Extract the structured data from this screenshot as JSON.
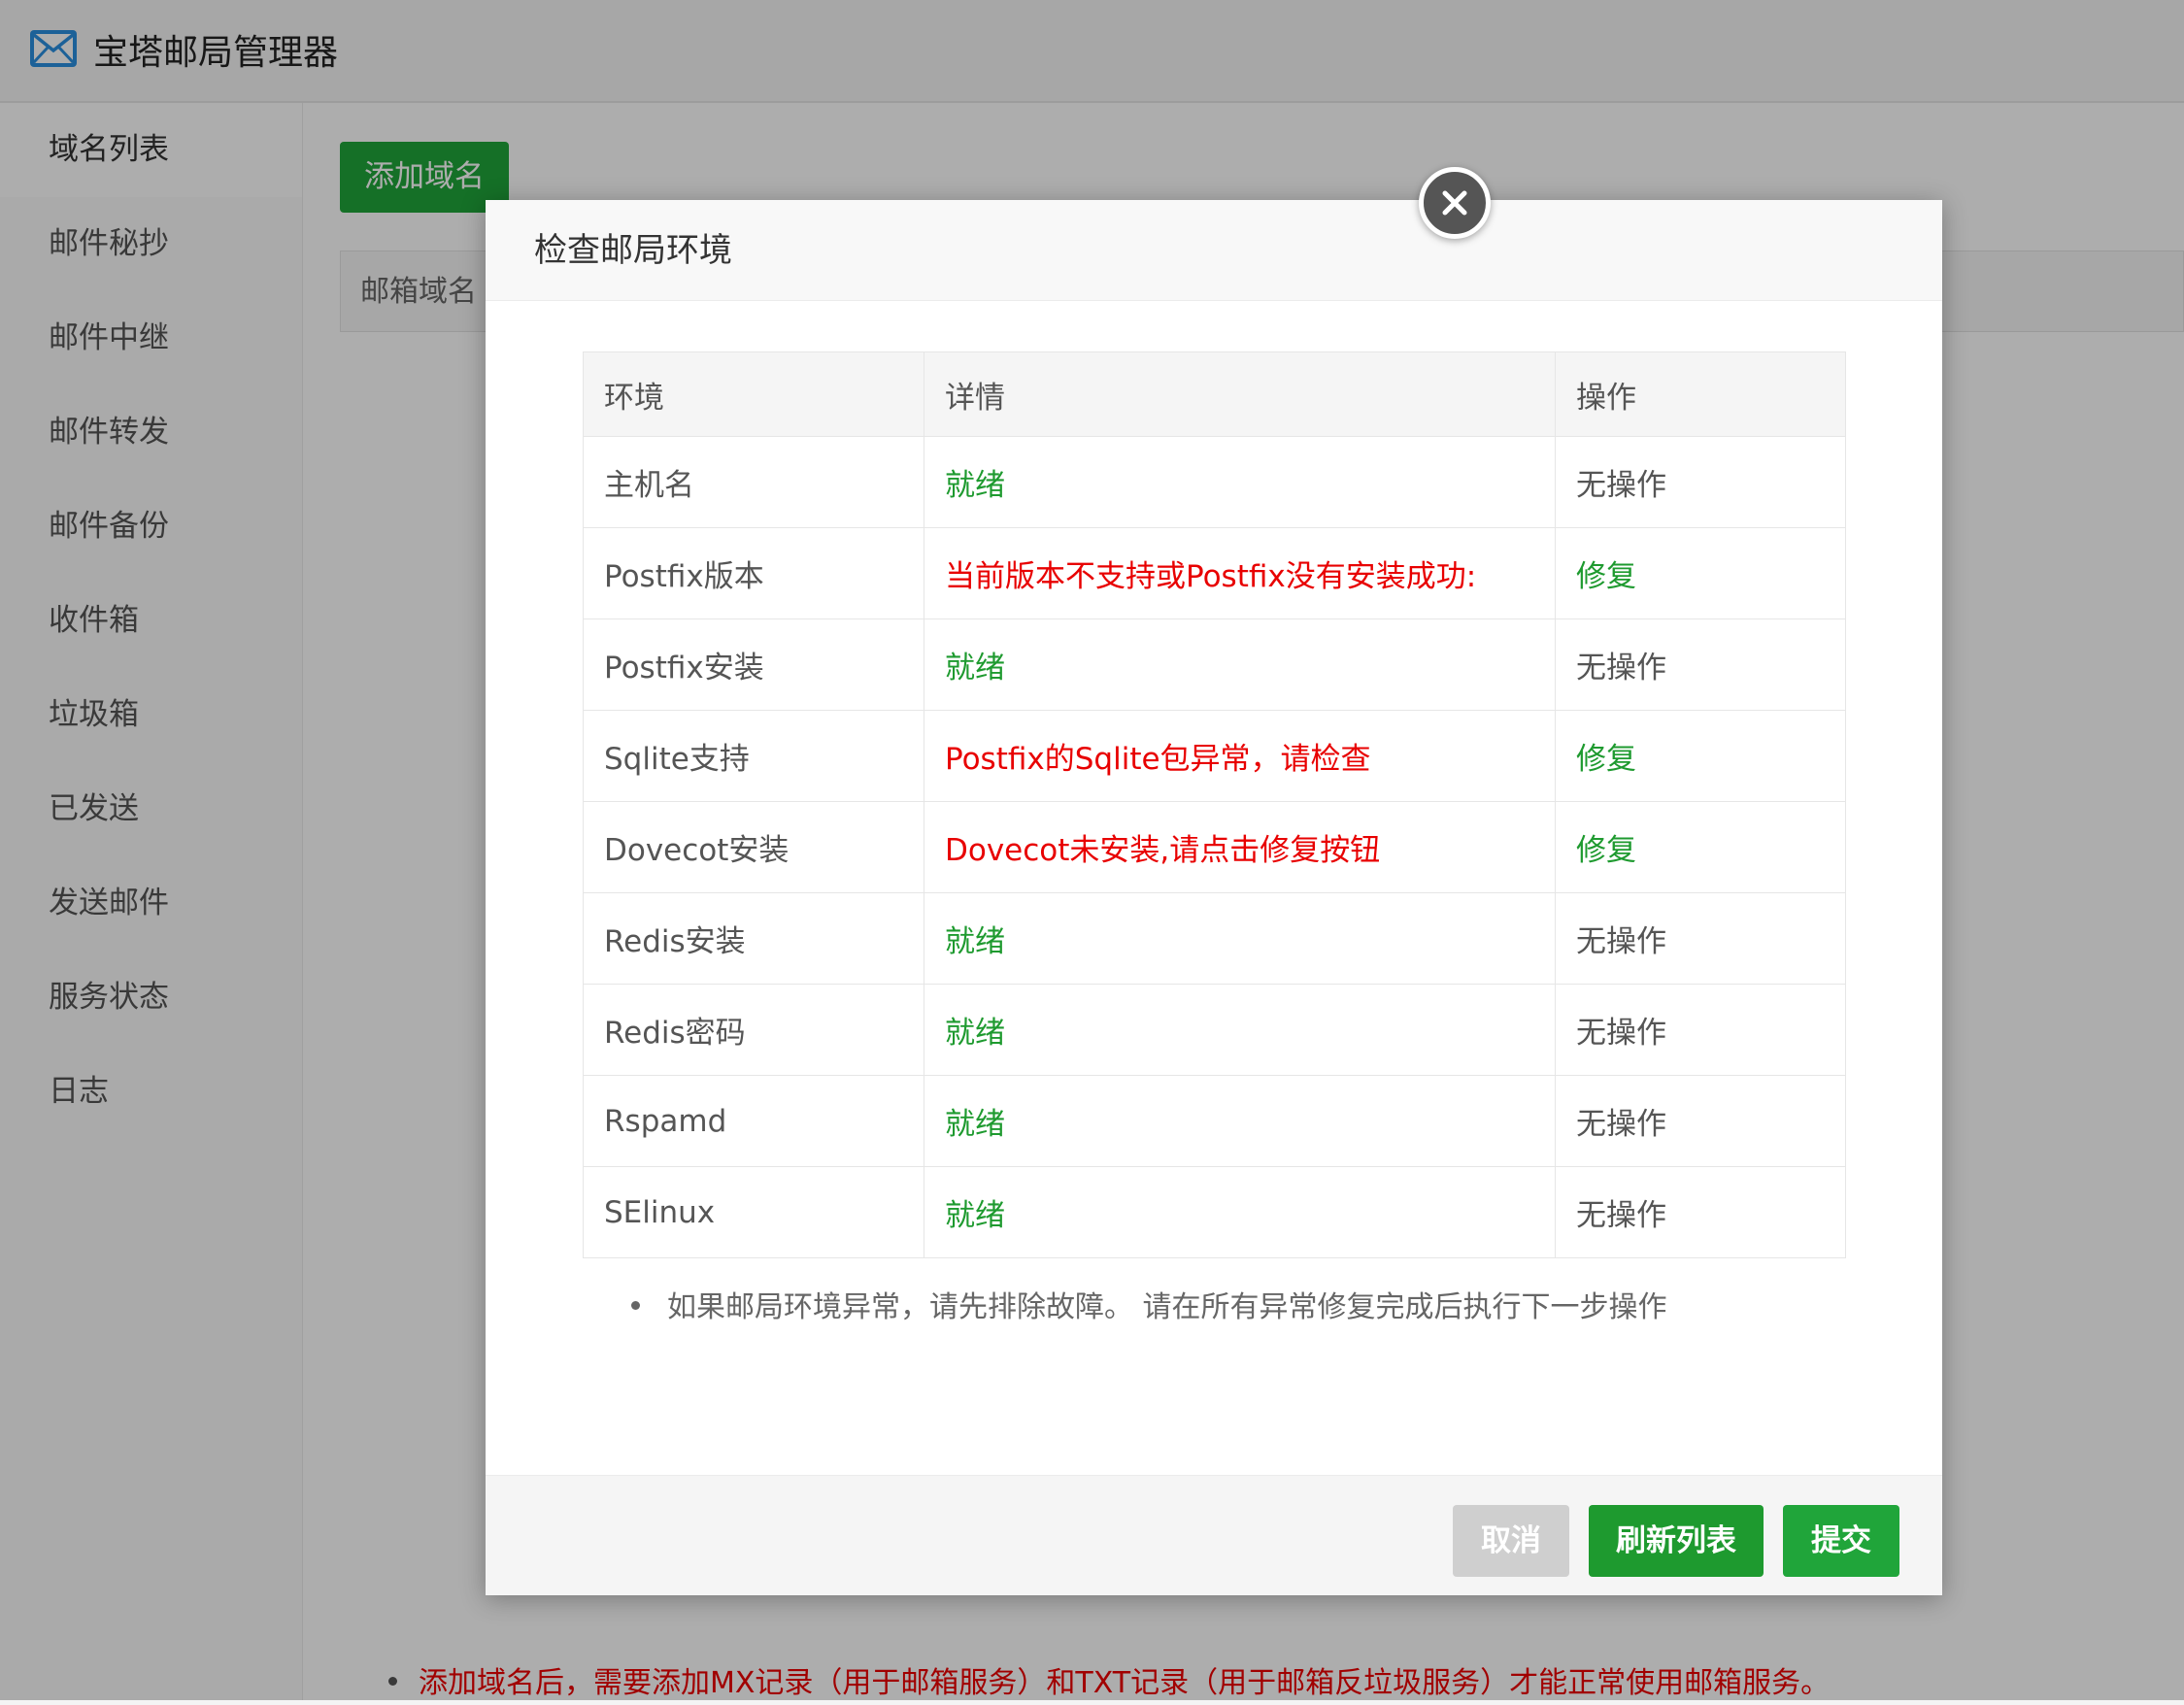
{
  "app": {
    "title": "宝塔邮局管理器",
    "accent_color": "#20a53a",
    "logo_icon": "envelope-icon"
  },
  "sidebar": {
    "items": [
      {
        "label": "域名列表",
        "active": true
      },
      {
        "label": "邮件秘抄"
      },
      {
        "label": "邮件中继"
      },
      {
        "label": "邮件转发"
      },
      {
        "label": "邮件备份"
      },
      {
        "label": "收件箱"
      },
      {
        "label": "垃圾箱"
      },
      {
        "label": "已发送"
      },
      {
        "label": "发送邮件"
      },
      {
        "label": "服务状态"
      },
      {
        "label": "日志"
      }
    ]
  },
  "main": {
    "add_domain_label": "添加域名",
    "table_header_first": "邮箱域名",
    "note": "添加域名后，需要添加MX记录（用于邮箱服务）和TXT记录（用于邮箱反垃圾服务）才能正常使用邮箱服务。"
  },
  "modal": {
    "title": "检查邮局环境",
    "close_icon": "close-icon",
    "columns": [
      "环境",
      "详情",
      "操作"
    ],
    "rows": [
      {
        "env": "主机名",
        "detail": "就绪",
        "status": "ok",
        "action": "无操作"
      },
      {
        "env": "Postfix版本",
        "detail": "当前版本不支持或Postfix没有安装成功:",
        "status": "error",
        "action": "修复"
      },
      {
        "env": "Postfix安装",
        "detail": "就绪",
        "status": "ok",
        "action": "无操作"
      },
      {
        "env": "Sqlite支持",
        "detail": "Postfix的Sqlite包异常，请检查",
        "status": "error",
        "action": "修复"
      },
      {
        "env": "Dovecot安装",
        "detail": "Dovecot未安装,请点击修复按钮",
        "status": "error",
        "action": "修复"
      },
      {
        "env": "Redis安装",
        "detail": "就绪",
        "status": "ok",
        "action": "无操作"
      },
      {
        "env": "Redis密码",
        "detail": "就绪",
        "status": "ok",
        "action": "无操作"
      },
      {
        "env": "Rspamd",
        "detail": "就绪",
        "status": "ok",
        "action": "无操作"
      },
      {
        "env": "SElinux",
        "detail": "就绪",
        "status": "ok",
        "action": "无操作"
      }
    ],
    "tip": "如果邮局环境异常，请先排除故障。 请在所有异常修复完成后执行下一步操作",
    "buttons": {
      "cancel": "取消",
      "refresh": "刷新列表",
      "submit": "提交"
    }
  },
  "colors": {
    "ok": "#1e9a2f",
    "error": "#e80000"
  }
}
